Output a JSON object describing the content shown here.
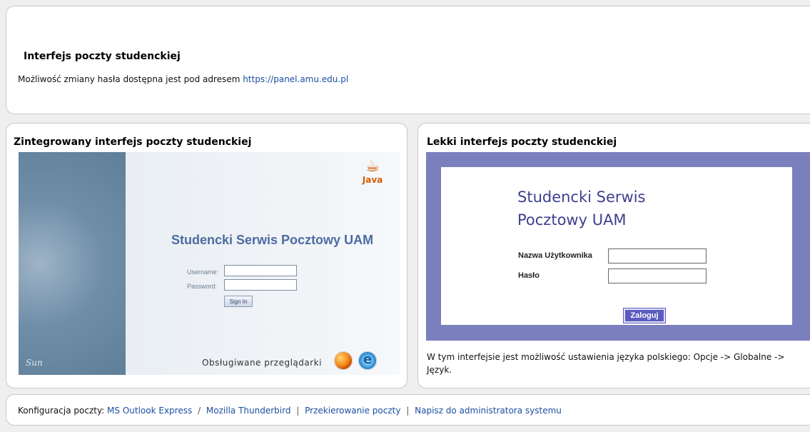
{
  "top": {
    "title": "Interfejs poczty studenckiej",
    "message": "Możliwość zmiany hasła dostępna jest pod adresem ",
    "link_text": "https://panel.amu.edu.pl"
  },
  "left": {
    "title": "Zintegrowany interfejs poczty studenckiej",
    "java_logo_text": "Java",
    "heading": "Studencki Serwis Pocztowy UAM",
    "username_label": "Username:",
    "password_label": "Password:",
    "sign_in_label": "Sign In",
    "browsers_text": "Obsługiwane przeglądarki",
    "sun_logo_text": "Sun",
    "icons": {
      "java": "java-icon",
      "firefox": "firefox-icon",
      "ie": "internet-explorer-icon"
    }
  },
  "right": {
    "title": "Lekki interfejs poczty studenckiej",
    "heading_line1": "Studencki Serwis",
    "heading_line2": "Pocztowy UAM",
    "username_label": "Nazwa Użytkownika",
    "password_label": "Hasło",
    "login_label": "Zaloguj",
    "note": "W tym interfejsie jest możliwość ustawienia języka polskiego: Opcje -> Globalne -> Język."
  },
  "footer": {
    "prefix": "Konfiguracja poczty: ",
    "links": [
      "MS Outlook Express",
      "Mozilla Thunderbird",
      "Przekierowanie poczty",
      "Napisz do administratora systemu"
    ],
    "separators": [
      " / ",
      " | ",
      " | "
    ]
  },
  "colors": {
    "link": "#1b4fa1",
    "light_panel": "#7b7fbe",
    "login_button": "#5b5bbf"
  }
}
